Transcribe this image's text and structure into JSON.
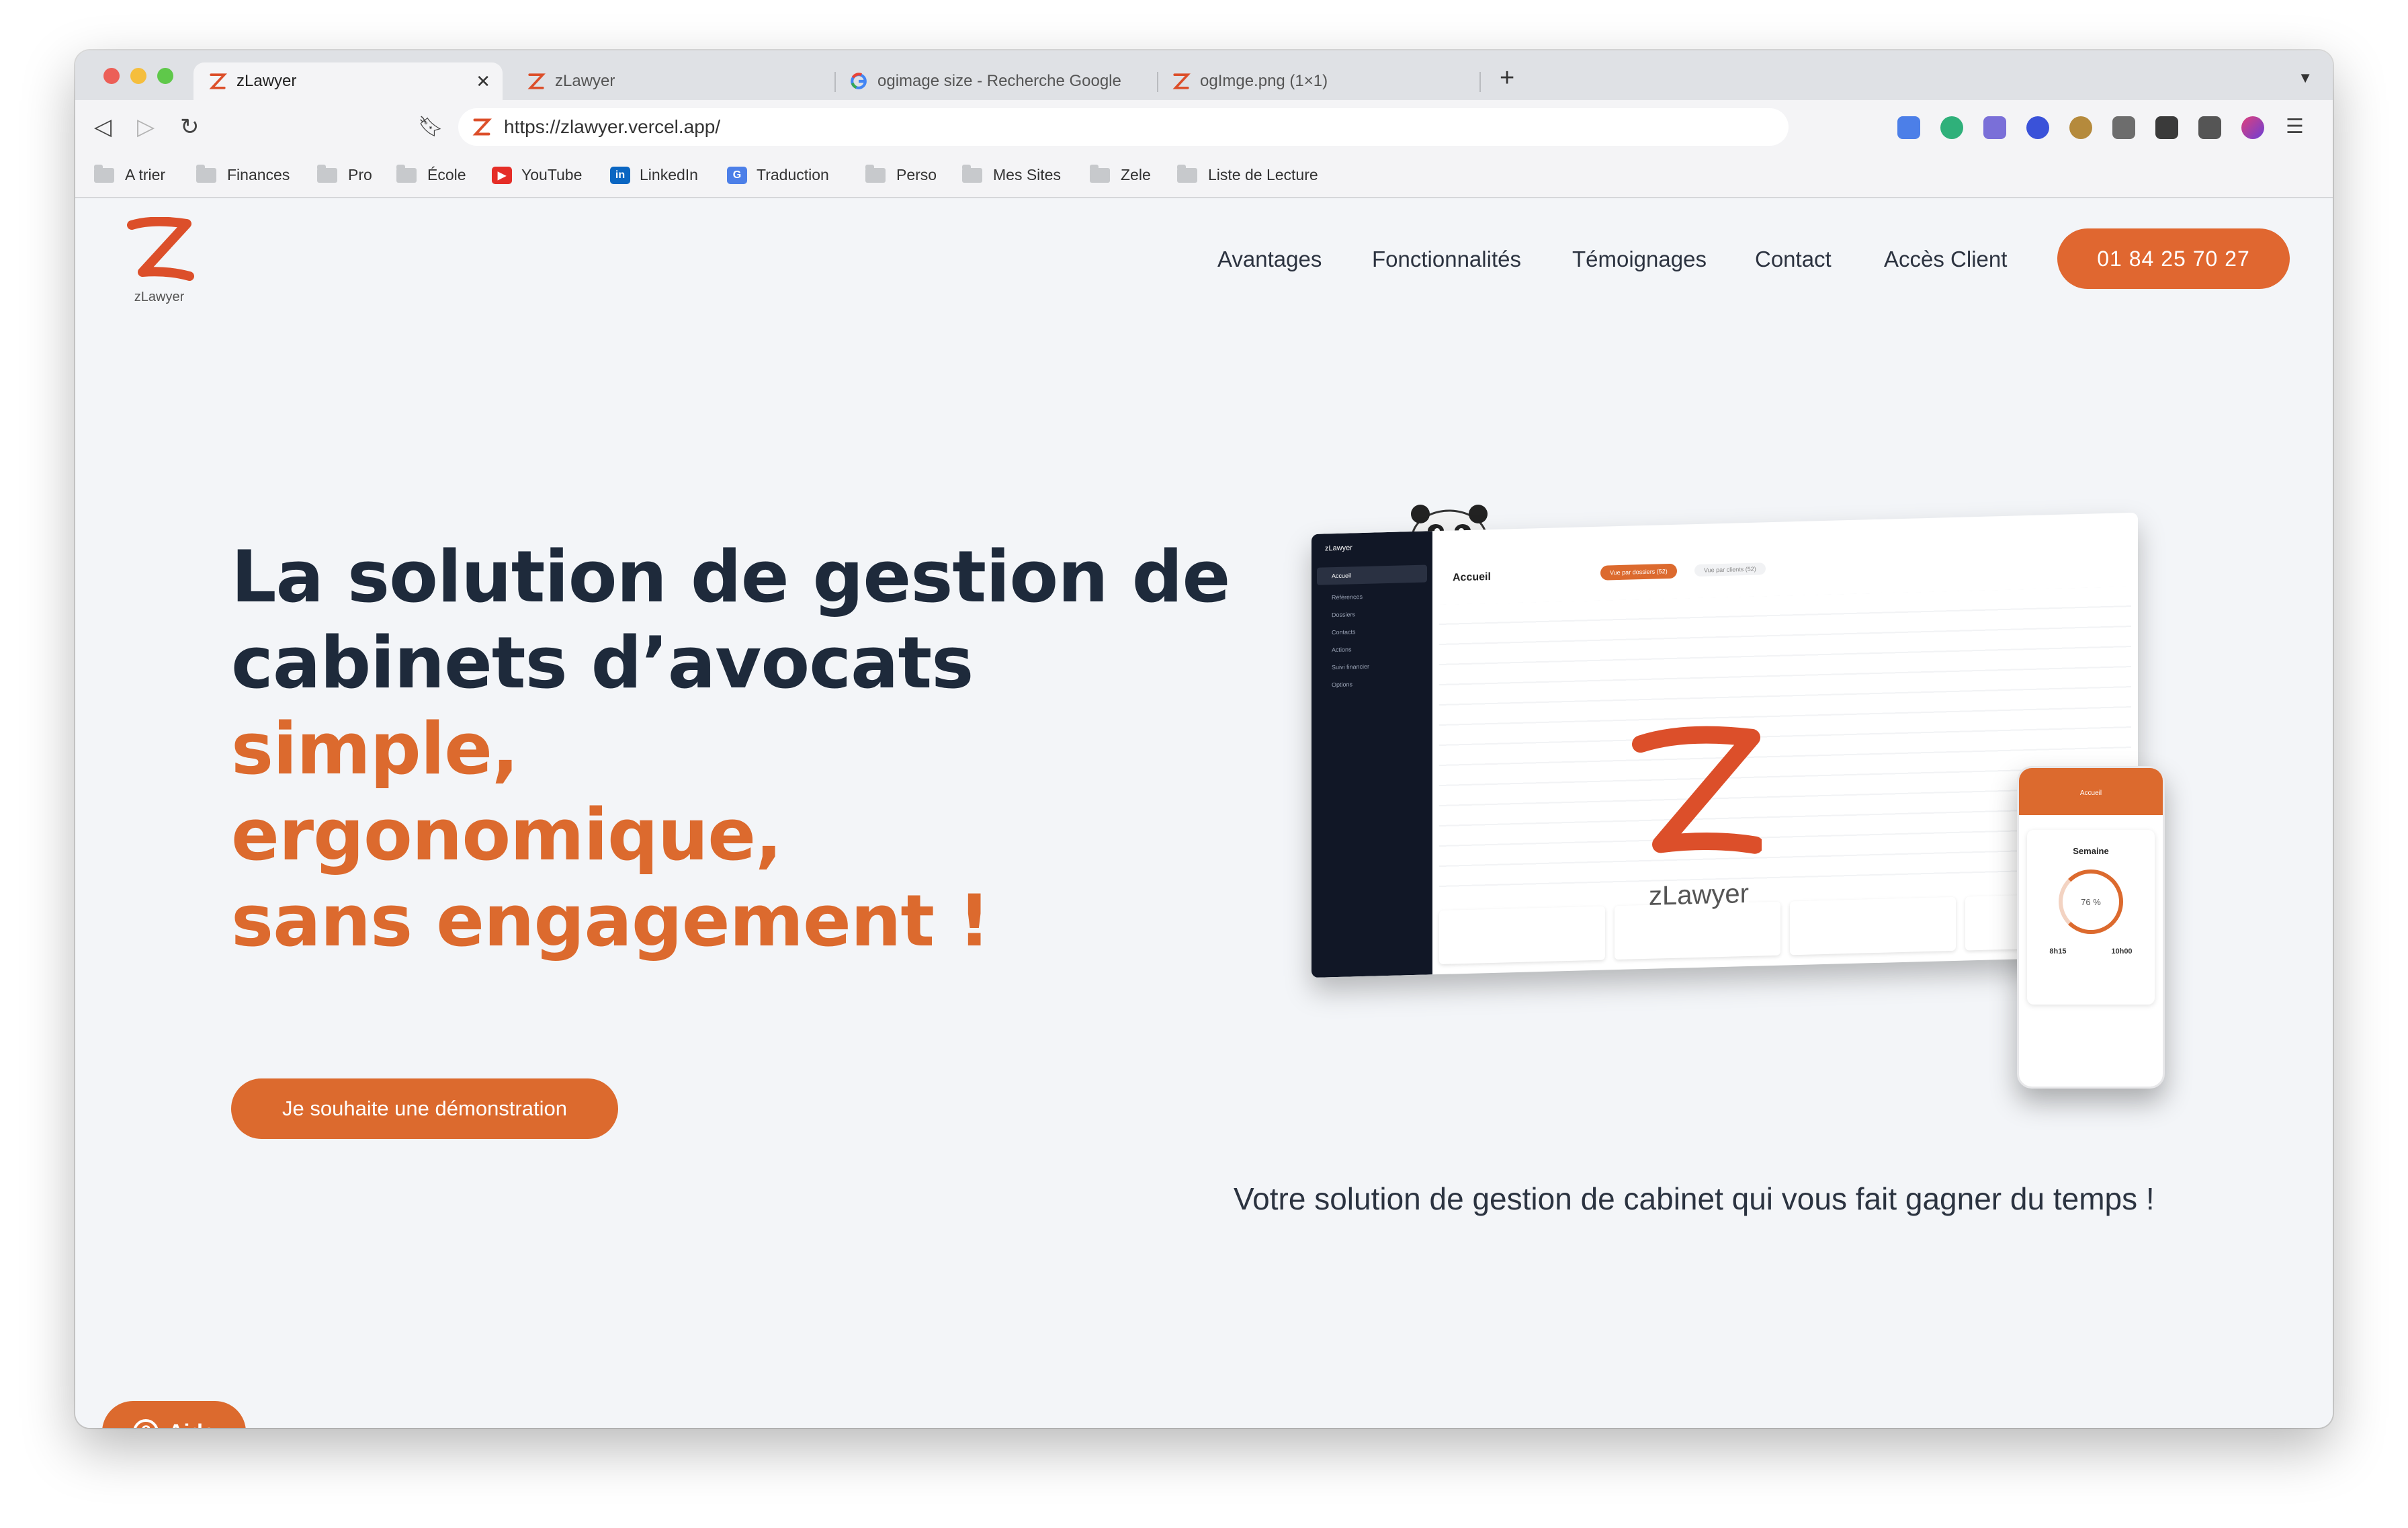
{
  "browser": {
    "tabs": [
      {
        "title": "zLawyer"
      },
      {
        "title": "zLawyer"
      },
      {
        "title": "ogimage size - Recherche Google"
      },
      {
        "title": "ogImge.png (1×1)"
      }
    ],
    "url": "https://zlawyer.vercel.app/",
    "bookmarks": [
      "A trier",
      "Finances",
      "Pro",
      "École",
      "YouTube",
      "LinkedIn",
      "Traduction",
      "Perso",
      "Mes Sites",
      "Zele",
      "Liste de Lecture"
    ]
  },
  "site": {
    "logo_text": "zLawyer",
    "nav": [
      "Avantages",
      "Fonctionnalités",
      "Témoignages",
      "Contact",
      "Accès Client"
    ],
    "phone": "01 84 25 70 27",
    "hero": {
      "line1": "La solution de gestion de",
      "line2": "cabinets d’avocats",
      "line3": "simple,",
      "line4": "ergonomique,",
      "line5": "sans engagement !"
    },
    "cta": "Je souhaite une démonstration",
    "tagline": "Votre solution de gestion de cabinet qui vous fait gagner du temps !",
    "help": "Aide",
    "mockup": {
      "app_name": "zLawyer",
      "page_title": "Accueil",
      "tab_active": "Vue par dossiers (52)",
      "tab_other": "Vue par clients (52)",
      "overlay_brand": "zLawyer",
      "sidebar": [
        "Accueil",
        "Références",
        "Dossiers",
        "Contacts",
        "Actions",
        "Suivi financier",
        "Options"
      ],
      "phone_title": "Accueil",
      "phone_section": "Semaine",
      "phone_percent": "76 %",
      "phone_time_a": "8h15",
      "phone_time_b": "10h00"
    }
  },
  "colors": {
    "accent": "#dc6a2e",
    "dark": "#1e2a3b"
  }
}
